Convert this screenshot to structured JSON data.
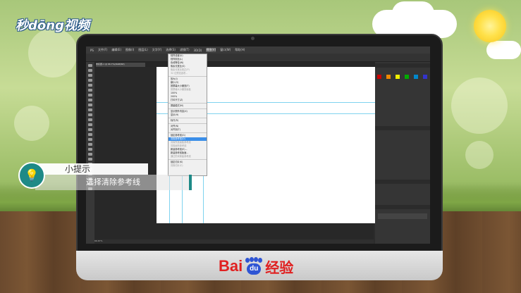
{
  "branding": {
    "logo_text": "秒dōng视频",
    "footer_brand_latin": "Bai",
    "footer_brand_paw": "du",
    "footer_brand_cn": "经验"
  },
  "tip": {
    "title": "小提示",
    "text": "选择清除参考线"
  },
  "photoshop": {
    "menubar": [
      "PS",
      "文件(F)",
      "编辑(E)",
      "图像(I)",
      "图层(L)",
      "文字(Y)",
      "选择(S)",
      "滤镜(T)",
      "3D(D)",
      "视图(V)",
      "窗口(W)",
      "帮助(H)"
    ],
    "active_menu": "视图(V)",
    "doc_tab": "未标题-1 @ 66.7%(RGB/8#)",
    "status": "66.67%",
    "view_menu": {
      "items": [
        {
          "label": "校样设置(U)",
          "state": "normal"
        },
        {
          "label": "校样颜色(L)",
          "state": "normal"
        },
        {
          "label": "色域警告(W)",
          "state": "normal"
        },
        {
          "label": "像素长宽比(S)",
          "state": "normal"
        },
        {
          "label": "像素长宽比校正(P)",
          "state": "disabled"
        },
        {
          "label": "32 位预览选项...",
          "state": "disabled"
        },
        {
          "sep": true
        },
        {
          "label": "放大(I)",
          "state": "normal"
        },
        {
          "label": "缩小(O)",
          "state": "normal"
        },
        {
          "label": "按屏幕大小缩放(F)",
          "state": "normal"
        },
        {
          "label": "按屏幕大小缩放画板",
          "state": "disabled"
        },
        {
          "label": "100%",
          "state": "normal"
        },
        {
          "label": "200%",
          "state": "normal"
        },
        {
          "label": "打印尺寸(Z)",
          "state": "normal"
        },
        {
          "sep": true
        },
        {
          "label": "屏幕模式(M)",
          "state": "normal"
        },
        {
          "sep": true
        },
        {
          "label": "显示额外内容(X)",
          "state": "normal"
        },
        {
          "label": "显示(H)",
          "state": "normal"
        },
        {
          "sep": true
        },
        {
          "label": "标尺(R)",
          "state": "normal"
        },
        {
          "sep": true
        },
        {
          "label": "对齐(N)",
          "state": "normal"
        },
        {
          "label": "对齐到(T)",
          "state": "normal"
        },
        {
          "sep": true
        },
        {
          "label": "锁定参考线(G)",
          "state": "normal"
        },
        {
          "label": "清除参考线(D)",
          "state": "selected"
        },
        {
          "label": "清除所选画板参考线",
          "state": "disabled"
        },
        {
          "label": "清除画布参考线",
          "state": "disabled"
        },
        {
          "label": "新建参考线(E)...",
          "state": "normal"
        },
        {
          "label": "新建参考线版面...",
          "state": "normal"
        },
        {
          "label": "通过形状新建参考线",
          "state": "disabled"
        },
        {
          "sep": true
        },
        {
          "label": "锁定切片(K)",
          "state": "normal"
        },
        {
          "label": "清除切片(C)",
          "state": "disabled"
        }
      ]
    }
  },
  "colors": {
    "accent_teal": "#1e8a87",
    "menu_highlight": "#3b8ee8",
    "guide_cyan": "#7fd3ef",
    "baidu_red": "#e02020",
    "baidu_blue": "#2f55d4"
  }
}
